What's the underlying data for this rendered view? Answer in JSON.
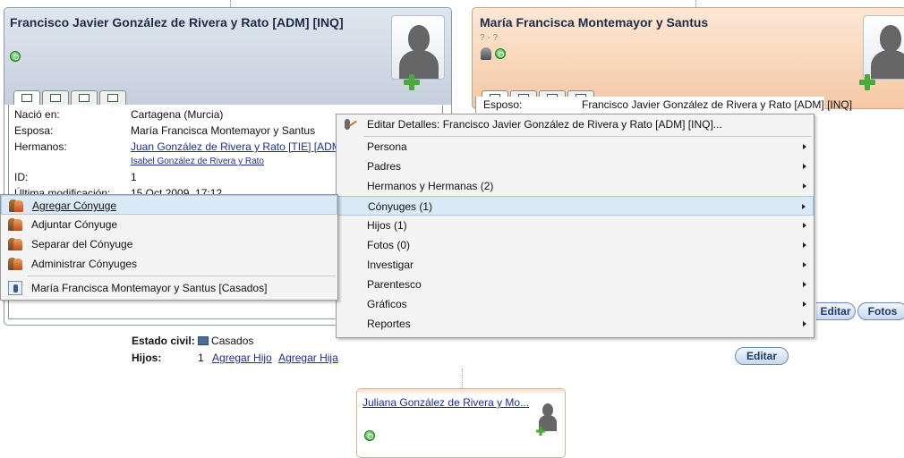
{
  "father": {
    "name": "Francisco Javier González de Rivera y Rato [ADM] [INQ]",
    "fields": [
      {
        "label": "Nació en:",
        "value": "Cartagena (Murcia)"
      },
      {
        "label": "Esposa:",
        "value": "María Francisca Montemayor y Santus"
      },
      {
        "label": "Hermanos:",
        "value": "Juan González de Rivera y Rato [TIE] [ADM]",
        "extra": "Isabel González de Rivera y Rato"
      },
      {
        "label": "ID:",
        "value": "1"
      },
      {
        "label": "Última modificación:",
        "value": "15 Oct 2009, 17:12"
      }
    ]
  },
  "mother": {
    "name": "María Francisca Montemayor y Santus",
    "dates": "? - ?",
    "field_label": "Esposo:",
    "field_value": "Francisco Javier González de Rivera y Rato [ADM] [INQ]"
  },
  "context_menu": {
    "items": [
      {
        "label": "Editar Detalles: Francisco Javier González de Rivera y Rato [ADM] [INQ]...",
        "icon": "edit-person-icon"
      },
      {
        "label": "Persona"
      },
      {
        "label": "Padres"
      },
      {
        "label": "Hermanos y Hermanas (2)"
      },
      {
        "label": "Cónyuges (1)"
      },
      {
        "label": "Hijos (1)"
      },
      {
        "label": "Fotos (0)"
      },
      {
        "label": "Investigar"
      },
      {
        "label": "Parentesco"
      },
      {
        "label": "Gráficos"
      },
      {
        "label": "Reportes"
      }
    ]
  },
  "submenu": {
    "items": [
      {
        "label": "Agregar Cónyuge",
        "icon": "add-spouse-icon"
      },
      {
        "label": "Adjuntar Cónyuge",
        "icon": "attach-spouse-icon"
      },
      {
        "label": "Separar del Cónyuge",
        "icon": "separate-spouse-icon"
      },
      {
        "label": "Administrar Cónyuges",
        "icon": "manage-spouses-icon"
      },
      {
        "label": "María Francisca Montemayor y Santus   [Casados]",
        "icon": "person-icon"
      }
    ]
  },
  "buttons": {
    "editar_top": "Editar",
    "fotos": "Fotos",
    "editar_family": "Editar"
  },
  "family": {
    "estado_label": "Estado civil:",
    "estado_value": "Casados",
    "hijos_label": "Hijos:",
    "hijos_count": "1",
    "add_son": "Agregar Hijo",
    "add_daughter": "Agregar Hija"
  },
  "child": {
    "name": "Juliana González de Rivera y Mo..."
  },
  "colors": {
    "male_header": "#c5cfdc",
    "female_header": "#f4c8a4",
    "menu_highlight": "#dceaf7",
    "link": "#1d2c9a"
  }
}
